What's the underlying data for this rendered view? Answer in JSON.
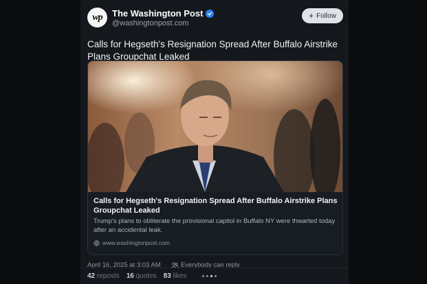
{
  "post": {
    "author": {
      "avatar_glyph": "wp",
      "name": "The Washington Post",
      "handle": "@washingtonpost.com",
      "verified": true
    },
    "follow_label": "Follow",
    "text": "Calls for Hegseth's Resignation Spread After Buffalo Airstrike Plans Groupchat Leaked",
    "link_card": {
      "title": "Calls for Hegseth's Resignation Spread After Buffalo Airstrike Plans Groupchat Leaked",
      "description": "Trump's plans to obliterate the provisional capitol in Buffalo NY were thwarted today after an accidental leak.",
      "domain": "www.washingtonpost.com"
    },
    "timestamp": "April 16, 2025 at 3:03 AM",
    "separator": "·",
    "reply_setting": "Everybody can reply",
    "stats": {
      "reposts_count": "42",
      "reposts_label": "reposts",
      "quotes_count": "16",
      "quotes_label": "quotes",
      "likes_count": "83",
      "likes_label": "likes"
    }
  },
  "colors": {
    "background": "#0b0c0e",
    "panel": "#14181d",
    "verified": "#2f80ed",
    "follow_button": "#dfe3e8"
  }
}
